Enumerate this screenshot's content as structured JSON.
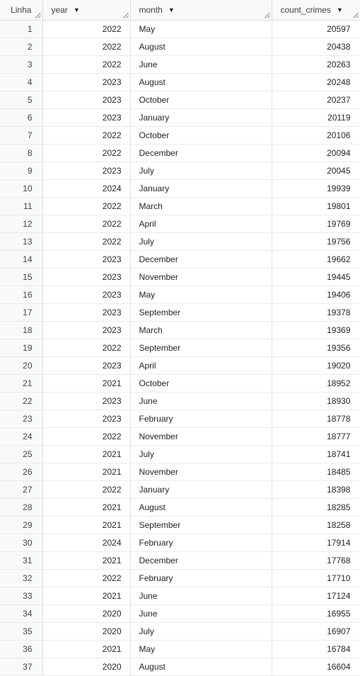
{
  "headers": {
    "index": "Linha",
    "year": "year",
    "month": "month",
    "count": "count_crimes"
  },
  "icons": {
    "sort": "caret-down-icon",
    "resize": "resize-grip-icon"
  },
  "rows": [
    {
      "n": "1",
      "year": "2022",
      "month": "May",
      "count": "20597"
    },
    {
      "n": "2",
      "year": "2022",
      "month": "August",
      "count": "20438"
    },
    {
      "n": "3",
      "year": "2022",
      "month": "June",
      "count": "20263"
    },
    {
      "n": "4",
      "year": "2023",
      "month": "August",
      "count": "20248"
    },
    {
      "n": "5",
      "year": "2023",
      "month": "October",
      "count": "20237"
    },
    {
      "n": "6",
      "year": "2023",
      "month": "January",
      "count": "20119"
    },
    {
      "n": "7",
      "year": "2022",
      "month": "October",
      "count": "20106"
    },
    {
      "n": "8",
      "year": "2022",
      "month": "December",
      "count": "20094"
    },
    {
      "n": "9",
      "year": "2023",
      "month": "July",
      "count": "20045"
    },
    {
      "n": "10",
      "year": "2024",
      "month": "January",
      "count": "19939"
    },
    {
      "n": "11",
      "year": "2022",
      "month": "March",
      "count": "19801"
    },
    {
      "n": "12",
      "year": "2022",
      "month": "April",
      "count": "19769"
    },
    {
      "n": "13",
      "year": "2022",
      "month": "July",
      "count": "19756"
    },
    {
      "n": "14",
      "year": "2023",
      "month": "December",
      "count": "19662"
    },
    {
      "n": "15",
      "year": "2023",
      "month": "November",
      "count": "19445"
    },
    {
      "n": "16",
      "year": "2023",
      "month": "May",
      "count": "19406"
    },
    {
      "n": "17",
      "year": "2023",
      "month": "September",
      "count": "19378"
    },
    {
      "n": "18",
      "year": "2023",
      "month": "March",
      "count": "19369"
    },
    {
      "n": "19",
      "year": "2022",
      "month": "September",
      "count": "19356"
    },
    {
      "n": "20",
      "year": "2023",
      "month": "April",
      "count": "19020"
    },
    {
      "n": "21",
      "year": "2021",
      "month": "October",
      "count": "18952"
    },
    {
      "n": "22",
      "year": "2023",
      "month": "June",
      "count": "18930"
    },
    {
      "n": "23",
      "year": "2023",
      "month": "February",
      "count": "18778"
    },
    {
      "n": "24",
      "year": "2022",
      "month": "November",
      "count": "18777"
    },
    {
      "n": "25",
      "year": "2021",
      "month": "July",
      "count": "18741"
    },
    {
      "n": "26",
      "year": "2021",
      "month": "November",
      "count": "18485"
    },
    {
      "n": "27",
      "year": "2022",
      "month": "January",
      "count": "18398"
    },
    {
      "n": "28",
      "year": "2021",
      "month": "August",
      "count": "18285"
    },
    {
      "n": "29",
      "year": "2021",
      "month": "September",
      "count": "18258"
    },
    {
      "n": "30",
      "year": "2024",
      "month": "February",
      "count": "17914"
    },
    {
      "n": "31",
      "year": "2021",
      "month": "December",
      "count": "17768"
    },
    {
      "n": "32",
      "year": "2022",
      "month": "February",
      "count": "17710"
    },
    {
      "n": "33",
      "year": "2021",
      "month": "June",
      "count": "17124"
    },
    {
      "n": "34",
      "year": "2020",
      "month": "June",
      "count": "16955"
    },
    {
      "n": "35",
      "year": "2020",
      "month": "July",
      "count": "16907"
    },
    {
      "n": "36",
      "year": "2021",
      "month": "May",
      "count": "16784"
    },
    {
      "n": "37",
      "year": "2020",
      "month": "August",
      "count": "16604"
    }
  ]
}
